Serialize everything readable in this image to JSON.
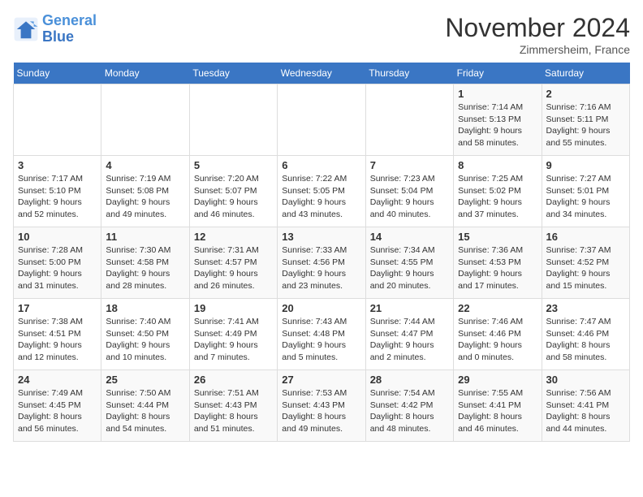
{
  "header": {
    "logo_line1": "General",
    "logo_line2": "Blue",
    "month": "November 2024",
    "location": "Zimmersheim, France"
  },
  "days_of_week": [
    "Sunday",
    "Monday",
    "Tuesday",
    "Wednesday",
    "Thursday",
    "Friday",
    "Saturday"
  ],
  "weeks": [
    [
      {
        "day": "",
        "info": ""
      },
      {
        "day": "",
        "info": ""
      },
      {
        "day": "",
        "info": ""
      },
      {
        "day": "",
        "info": ""
      },
      {
        "day": "",
        "info": ""
      },
      {
        "day": "1",
        "info": "Sunrise: 7:14 AM\nSunset: 5:13 PM\nDaylight: 9 hours and 58 minutes."
      },
      {
        "day": "2",
        "info": "Sunrise: 7:16 AM\nSunset: 5:11 PM\nDaylight: 9 hours and 55 minutes."
      }
    ],
    [
      {
        "day": "3",
        "info": "Sunrise: 7:17 AM\nSunset: 5:10 PM\nDaylight: 9 hours and 52 minutes."
      },
      {
        "day": "4",
        "info": "Sunrise: 7:19 AM\nSunset: 5:08 PM\nDaylight: 9 hours and 49 minutes."
      },
      {
        "day": "5",
        "info": "Sunrise: 7:20 AM\nSunset: 5:07 PM\nDaylight: 9 hours and 46 minutes."
      },
      {
        "day": "6",
        "info": "Sunrise: 7:22 AM\nSunset: 5:05 PM\nDaylight: 9 hours and 43 minutes."
      },
      {
        "day": "7",
        "info": "Sunrise: 7:23 AM\nSunset: 5:04 PM\nDaylight: 9 hours and 40 minutes."
      },
      {
        "day": "8",
        "info": "Sunrise: 7:25 AM\nSunset: 5:02 PM\nDaylight: 9 hours and 37 minutes."
      },
      {
        "day": "9",
        "info": "Sunrise: 7:27 AM\nSunset: 5:01 PM\nDaylight: 9 hours and 34 minutes."
      }
    ],
    [
      {
        "day": "10",
        "info": "Sunrise: 7:28 AM\nSunset: 5:00 PM\nDaylight: 9 hours and 31 minutes."
      },
      {
        "day": "11",
        "info": "Sunrise: 7:30 AM\nSunset: 4:58 PM\nDaylight: 9 hours and 28 minutes."
      },
      {
        "day": "12",
        "info": "Sunrise: 7:31 AM\nSunset: 4:57 PM\nDaylight: 9 hours and 26 minutes."
      },
      {
        "day": "13",
        "info": "Sunrise: 7:33 AM\nSunset: 4:56 PM\nDaylight: 9 hours and 23 minutes."
      },
      {
        "day": "14",
        "info": "Sunrise: 7:34 AM\nSunset: 4:55 PM\nDaylight: 9 hours and 20 minutes."
      },
      {
        "day": "15",
        "info": "Sunrise: 7:36 AM\nSunset: 4:53 PM\nDaylight: 9 hours and 17 minutes."
      },
      {
        "day": "16",
        "info": "Sunrise: 7:37 AM\nSunset: 4:52 PM\nDaylight: 9 hours and 15 minutes."
      }
    ],
    [
      {
        "day": "17",
        "info": "Sunrise: 7:38 AM\nSunset: 4:51 PM\nDaylight: 9 hours and 12 minutes."
      },
      {
        "day": "18",
        "info": "Sunrise: 7:40 AM\nSunset: 4:50 PM\nDaylight: 9 hours and 10 minutes."
      },
      {
        "day": "19",
        "info": "Sunrise: 7:41 AM\nSunset: 4:49 PM\nDaylight: 9 hours and 7 minutes."
      },
      {
        "day": "20",
        "info": "Sunrise: 7:43 AM\nSunset: 4:48 PM\nDaylight: 9 hours and 5 minutes."
      },
      {
        "day": "21",
        "info": "Sunrise: 7:44 AM\nSunset: 4:47 PM\nDaylight: 9 hours and 2 minutes."
      },
      {
        "day": "22",
        "info": "Sunrise: 7:46 AM\nSunset: 4:46 PM\nDaylight: 9 hours and 0 minutes."
      },
      {
        "day": "23",
        "info": "Sunrise: 7:47 AM\nSunset: 4:46 PM\nDaylight: 8 hours and 58 minutes."
      }
    ],
    [
      {
        "day": "24",
        "info": "Sunrise: 7:49 AM\nSunset: 4:45 PM\nDaylight: 8 hours and 56 minutes."
      },
      {
        "day": "25",
        "info": "Sunrise: 7:50 AM\nSunset: 4:44 PM\nDaylight: 8 hours and 54 minutes."
      },
      {
        "day": "26",
        "info": "Sunrise: 7:51 AM\nSunset: 4:43 PM\nDaylight: 8 hours and 51 minutes."
      },
      {
        "day": "27",
        "info": "Sunrise: 7:53 AM\nSunset: 4:43 PM\nDaylight: 8 hours and 49 minutes."
      },
      {
        "day": "28",
        "info": "Sunrise: 7:54 AM\nSunset: 4:42 PM\nDaylight: 8 hours and 48 minutes."
      },
      {
        "day": "29",
        "info": "Sunrise: 7:55 AM\nSunset: 4:41 PM\nDaylight: 8 hours and 46 minutes."
      },
      {
        "day": "30",
        "info": "Sunrise: 7:56 AM\nSunset: 4:41 PM\nDaylight: 8 hours and 44 minutes."
      }
    ]
  ]
}
